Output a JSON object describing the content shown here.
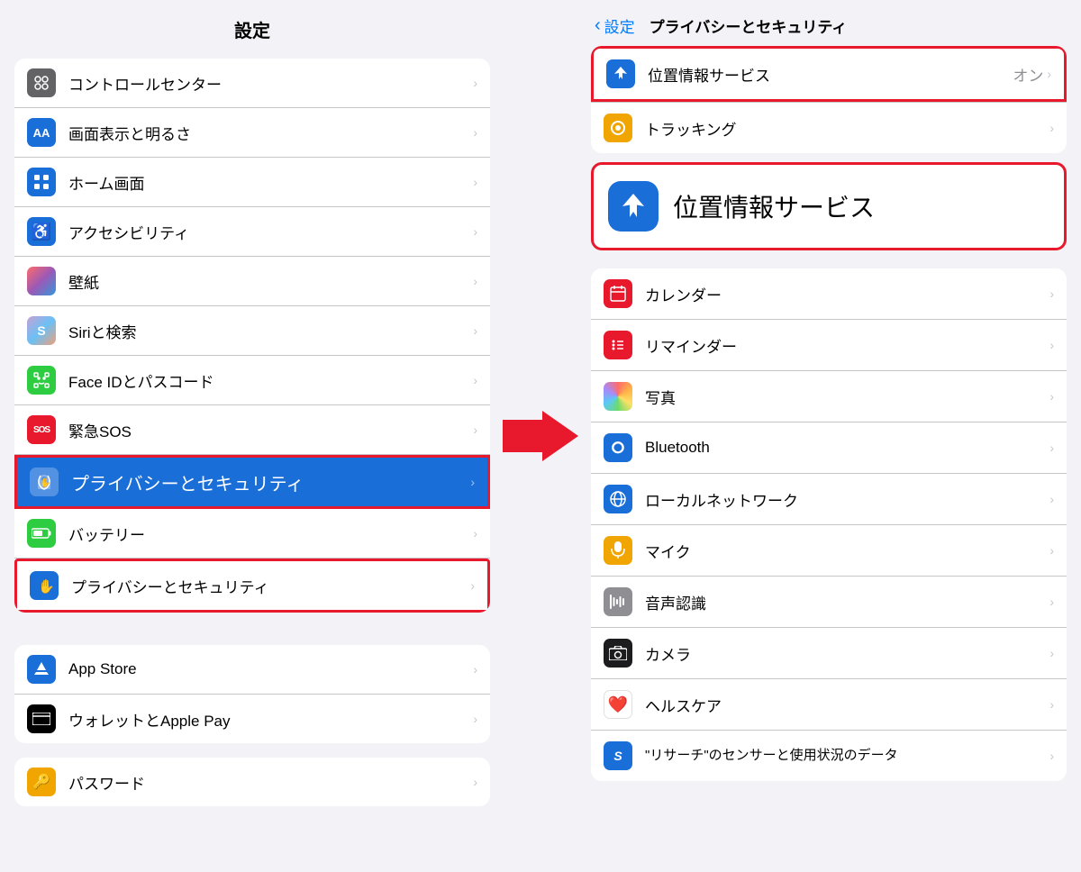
{
  "left": {
    "title": "設定",
    "items_top": [
      {
        "id": "control-center",
        "label": "コントロールセンター",
        "icon": "⊞",
        "bg": "#636366"
      },
      {
        "id": "display",
        "label": "画面表示と明るさ",
        "icon": "AA",
        "bg": "#1a6ed8",
        "text_icon": true
      },
      {
        "id": "home-screen",
        "label": "ホーム画面",
        "icon": "⊞",
        "bg": "#1a6ed8"
      },
      {
        "id": "accessibility",
        "label": "アクセシビリティ",
        "icon": "♿",
        "bg": "#1a6ed8"
      },
      {
        "id": "wallpaper",
        "label": "壁紙",
        "icon": "✿",
        "bg": "#636366"
      },
      {
        "id": "siri",
        "label": "Siriと検索",
        "icon": "◎",
        "bg": "#363636"
      },
      {
        "id": "face-id",
        "label": "Face IDとパスコード",
        "icon": "☺",
        "bg": "#2ecc40"
      },
      {
        "id": "emergency-sos",
        "label": "緊急SOS",
        "icon": "SOS",
        "bg": "#e8192c",
        "text_icon": true
      }
    ],
    "item_highlight": {
      "id": "privacy",
      "label": "プライバシーとセキュリティ",
      "icon": "✋",
      "bg": "rgba(255,255,255,0.3)"
    },
    "item_battery": {
      "id": "battery",
      "label": "バッテリー",
      "icon": "▬",
      "bg": "#2ecc40"
    },
    "item_privacy2": {
      "id": "privacy2",
      "label": "プライバシーとセキュリティ",
      "icon": "✋",
      "bg": "#1a6ed8"
    },
    "items_bottom": [
      {
        "id": "app-store",
        "label": "App Store",
        "icon": "A",
        "bg": "#1a6ed8"
      },
      {
        "id": "wallet",
        "label": "ウォレットとApple Pay",
        "icon": "≡",
        "bg": "#000"
      }
    ],
    "item_password": {
      "id": "password",
      "label": "パスワード",
      "icon": "🔑",
      "bg": "#f0a500"
    }
  },
  "right": {
    "back_label": "設定",
    "title": "プライバシーとセキュリティ",
    "location_services": {
      "label": "位置情報サービス",
      "value": "オン"
    },
    "tracking": {
      "label": "トラッキング"
    },
    "banner_label": "位置情報サービス",
    "items": [
      {
        "id": "calendar",
        "label": "カレンダー",
        "icon": "⊞",
        "bg": "#e8192c"
      },
      {
        "id": "reminders",
        "label": "リマインダー",
        "icon": "⊞",
        "bg": "#e8192c"
      },
      {
        "id": "photos",
        "label": "写真",
        "icon": "✿",
        "bg": "#636366"
      },
      {
        "id": "bluetooth",
        "label": "Bluetooth",
        "icon": "✦",
        "bg": "#1a6ed8"
      },
      {
        "id": "local-network",
        "label": "ローカルネットワーク",
        "icon": "⊕",
        "bg": "#1a6ed8"
      },
      {
        "id": "microphone",
        "label": "マイク",
        "icon": "◎",
        "bg": "#f0a500"
      },
      {
        "id": "speech-recognition",
        "label": "音声認識",
        "icon": "⊞",
        "bg": "#636366"
      },
      {
        "id": "camera",
        "label": "カメラ",
        "icon": "◎",
        "bg": "#1c1c1e"
      },
      {
        "id": "health",
        "label": "ヘルスケア",
        "icon": "♥",
        "bg": "#e8192c"
      },
      {
        "id": "research",
        "label": "\"リサーチ\"のセンサーと使用状況のデータ",
        "icon": "S",
        "bg": "#1a6ed8"
      }
    ]
  }
}
